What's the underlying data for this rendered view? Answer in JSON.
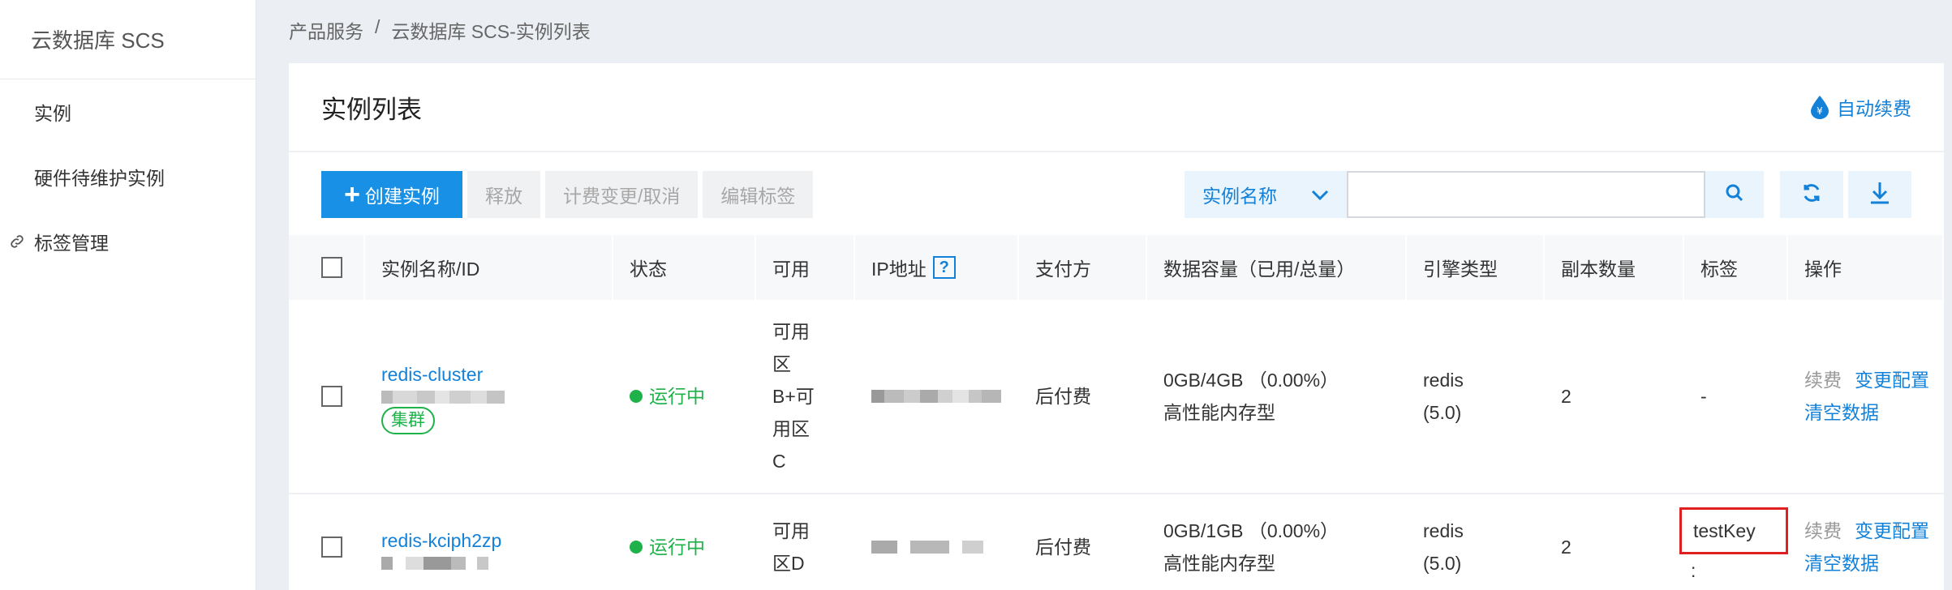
{
  "sidebar": {
    "title": "云数据库 SCS",
    "items": [
      {
        "label": "实例"
      },
      {
        "label": "硬件待维护实例"
      },
      {
        "label": "标签管理"
      }
    ]
  },
  "breadcrumb": {
    "parent": "产品服务",
    "separator": "/",
    "current": "云数据库 SCS-实例列表"
  },
  "page": {
    "title": "实例列表",
    "auto_renew_label": "自动续费"
  },
  "toolbar": {
    "create_label": "创建实例",
    "release_label": "释放",
    "billing_label": "计费变更/取消",
    "edit_tags_label": "编辑标签",
    "search_field_label": "实例名称",
    "search_placeholder": ""
  },
  "table": {
    "headers": {
      "name": "实例名称/ID",
      "status": "状态",
      "zone": "可用",
      "ip": "IP地址",
      "ip_help": "?",
      "payment": "支付方",
      "capacity": "数据容量（已用/总量）",
      "engine": "引擎类型",
      "replicas": "副本数量",
      "tags": "标签",
      "actions": "操作"
    },
    "rows": [
      {
        "name": "redis-cluster",
        "badge": "集群",
        "status": "运行中",
        "zone_lines": [
          "可用",
          "区",
          "B+可",
          "用区",
          "C"
        ],
        "payment": "后付费",
        "capacity": "0GB/4GB （0.00%）",
        "capacity_type": "高性能内存型",
        "engine": "redis",
        "engine_version": "(5.0)",
        "replicas": "2",
        "tag": "-",
        "action_renew": "续费",
        "action_change": "变更配置",
        "action_clear": "清空数据"
      },
      {
        "name": "redis-kciph2zp",
        "status": "运行中",
        "zone_lines": [
          "可用",
          "区D"
        ],
        "payment": "后付费",
        "capacity": "0GB/1GB （0.00%）",
        "capacity_type": "高性能内存型",
        "engine": "redis",
        "engine_version": "(5.0)",
        "replicas": "2",
        "tag": "testKey",
        "tag_suffix": ":",
        "action_renew": "续费",
        "action_change": "变更配置",
        "action_clear": "清空数据"
      }
    ]
  },
  "colors": {
    "primary": "#1890e6",
    "link": "#1481d8",
    "running": "#1fb24a",
    "highlight": "#e02020"
  }
}
